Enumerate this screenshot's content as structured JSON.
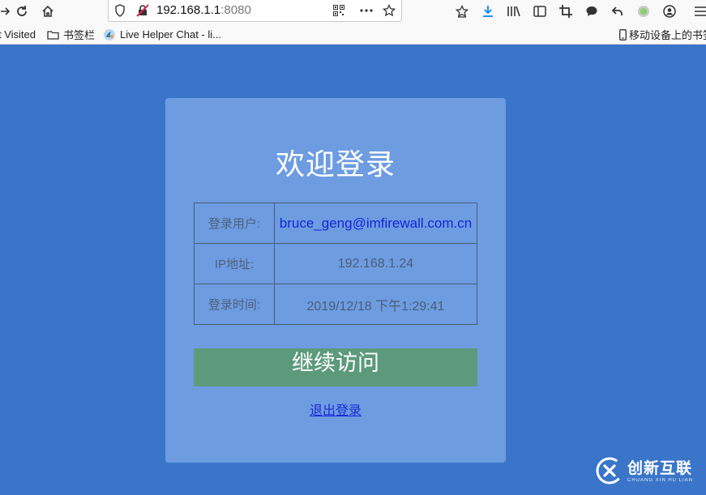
{
  "browser": {
    "url_host": "192.168.1.1",
    "url_port": ":8080",
    "bookmarks": [
      {
        "label": "t Visited"
      },
      {
        "label": "书签栏"
      },
      {
        "label": "Live Helper Chat - li..."
      },
      {
        "label": "移动设备上的书签"
      }
    ]
  },
  "login": {
    "title": "欢迎登录",
    "rows": [
      {
        "label": "登录用户:",
        "value": "bruce_geng@imfirewall.com.cn"
      },
      {
        "label": "IP地址:",
        "value": "192.168.1.24"
      },
      {
        "label": "登录时间:",
        "value": "2019/12/18 下午1:29:41"
      }
    ],
    "continue_label": "继续访问",
    "logout_label": "退出登录"
  },
  "watermark": {
    "name": "创新互联",
    "pinyin": "CHUANG XIN HU LIAN"
  },
  "colors": {
    "page_bg": "#3a75c9",
    "card_bg": "#6d9ce1",
    "button_bg": "#5c9a7c",
    "link": "#1a2ad8"
  }
}
